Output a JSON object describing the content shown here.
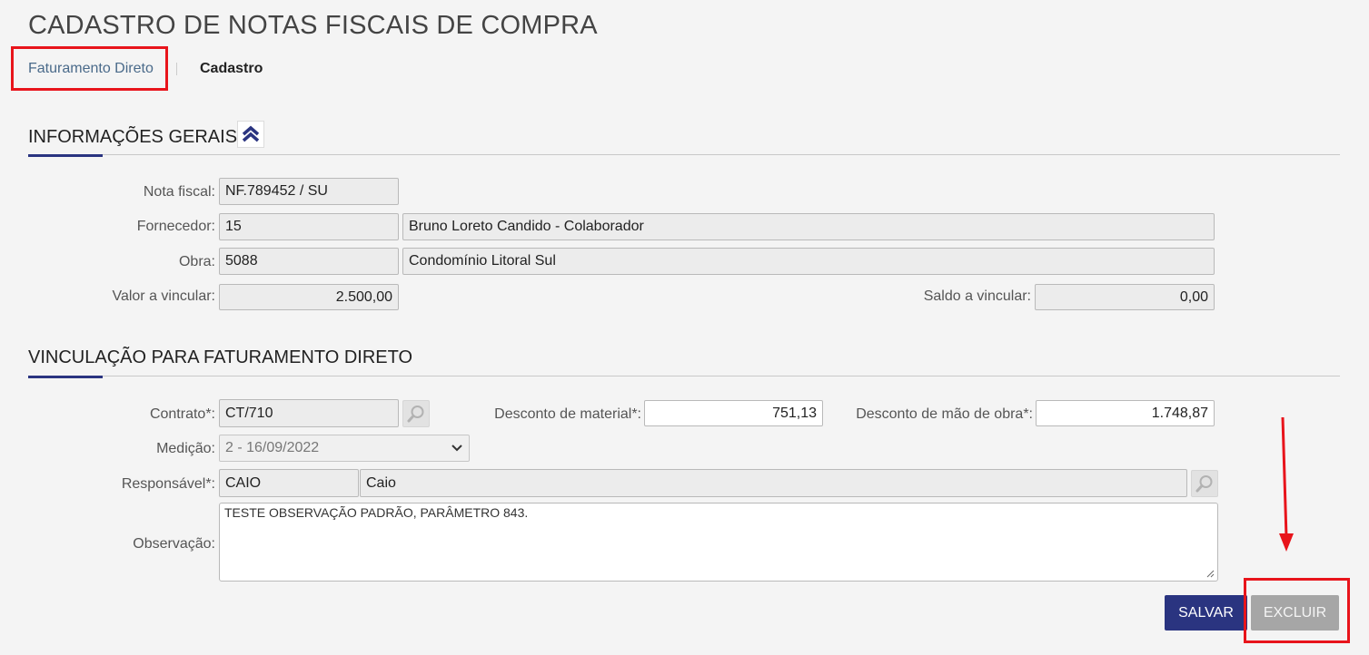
{
  "page": {
    "title": "CADASTRO DE NOTAS FISCAIS DE COMPRA"
  },
  "breadcrumb": {
    "active": "Faturamento Direto",
    "current": "Cadastro"
  },
  "sections": {
    "general": {
      "title": "INFORMAÇÕES GERAIS",
      "collapse_icon": "double-chevron-up-icon",
      "nota_fiscal": {
        "label": "Nota fiscal:",
        "value": "NF.789452 / SU"
      },
      "fornecedor": {
        "label": "Fornecedor:",
        "code": "15",
        "name": "Bruno Loreto Candido - Colaborador"
      },
      "obra": {
        "label": "Obra:",
        "code": "5088",
        "name": "Condomínio Litoral Sul"
      },
      "valor_vincular": {
        "label": "Valor a vincular:",
        "value": "2.500,00"
      },
      "saldo_vincular": {
        "label": "Saldo a vincular:",
        "value": "0,00"
      }
    },
    "vinculacao": {
      "title": "VINCULAÇÃO PARA FATURAMENTO DIRETO",
      "contrato": {
        "label": "Contrato*:",
        "value": "CT/710",
        "lookup_icon": "search-icon"
      },
      "desconto_material": {
        "label": "Desconto de material*:",
        "value": "751,13"
      },
      "desconto_mao_obra": {
        "label": "Desconto de mão de obra*:",
        "value": "1.748,87"
      },
      "medicao": {
        "label": "Medição:",
        "value": "2 - 16/09/2022",
        "icon": "chevron-down-icon"
      },
      "responsavel": {
        "label": "Responsável*:",
        "code": "CAIO",
        "name": "Caio",
        "lookup_icon": "search-icon"
      },
      "observacao": {
        "label": "Observação:",
        "value": "TESTE OBSERVAÇÃO PADRÃO, PARÂMETRO 843."
      }
    }
  },
  "actions": {
    "save_label": "SALVAR",
    "delete_label": "EXCLUIR"
  },
  "colors": {
    "accent": "#2a3480",
    "highlight": "#e8141b",
    "disabled": "#a6a6a6"
  }
}
